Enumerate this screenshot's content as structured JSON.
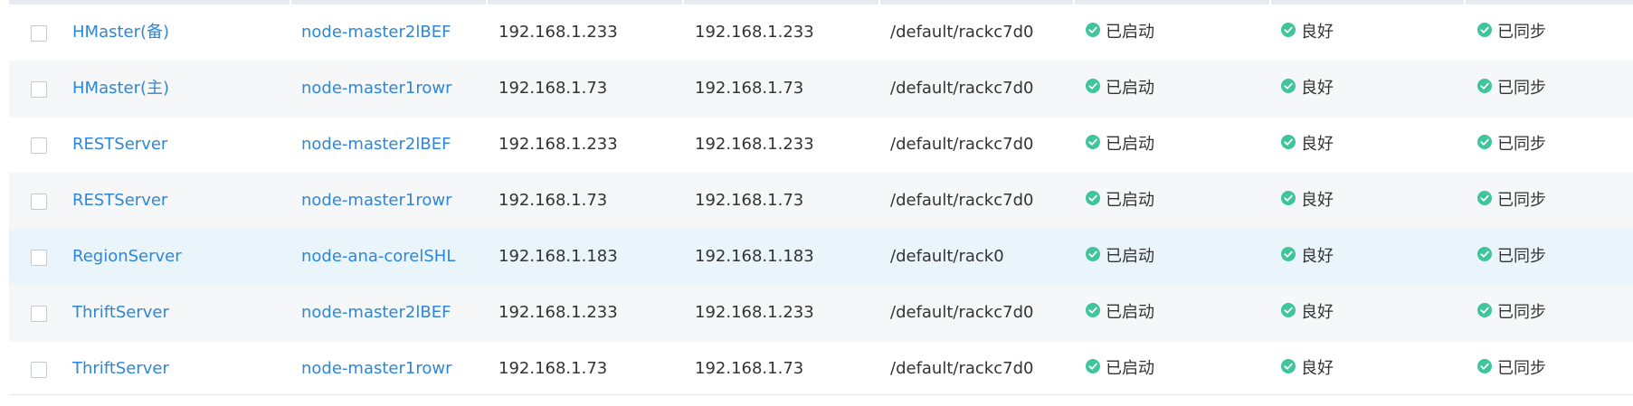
{
  "colors": {
    "link": "#2f86d6",
    "status_ok": "#3fc59b",
    "row_alt": "#f6f7f8",
    "row_highlight": "#eaf4fb"
  },
  "icons": {
    "status": "check-circle-icon"
  },
  "rows": [
    {
      "role": "HMaster(备)",
      "host": "node-master2lBEF",
      "ip1": "192.168.1.233",
      "ip2": "192.168.1.233",
      "rack": "/default/rackc7d0",
      "run_status": "已启动",
      "health": "良好",
      "sync": "已同步"
    },
    {
      "role": "HMaster(主)",
      "host": "node-master1rowr",
      "ip1": "192.168.1.73",
      "ip2": "192.168.1.73",
      "rack": "/default/rackc7d0",
      "run_status": "已启动",
      "health": "良好",
      "sync": "已同步"
    },
    {
      "role": "RESTServer",
      "host": "node-master2lBEF",
      "ip1": "192.168.1.233",
      "ip2": "192.168.1.233",
      "rack": "/default/rackc7d0",
      "run_status": "已启动",
      "health": "良好",
      "sync": "已同步"
    },
    {
      "role": "RESTServer",
      "host": "node-master1rowr",
      "ip1": "192.168.1.73",
      "ip2": "192.168.1.73",
      "rack": "/default/rackc7d0",
      "run_status": "已启动",
      "health": "良好",
      "sync": "已同步"
    },
    {
      "role": "RegionServer",
      "host": "node-ana-corelSHL",
      "ip1": "192.168.1.183",
      "ip2": "192.168.1.183",
      "rack": "/default/rack0",
      "run_status": "已启动",
      "health": "良好",
      "sync": "已同步"
    },
    {
      "role": "ThriftServer",
      "host": "node-master2lBEF",
      "ip1": "192.168.1.233",
      "ip2": "192.168.1.233",
      "rack": "/default/rackc7d0",
      "run_status": "已启动",
      "health": "良好",
      "sync": "已同步"
    },
    {
      "role": "ThriftServer",
      "host": "node-master1rowr",
      "ip1": "192.168.1.73",
      "ip2": "192.168.1.73",
      "rack": "/default/rackc7d0",
      "run_status": "已启动",
      "health": "良好",
      "sync": "已同步"
    }
  ]
}
